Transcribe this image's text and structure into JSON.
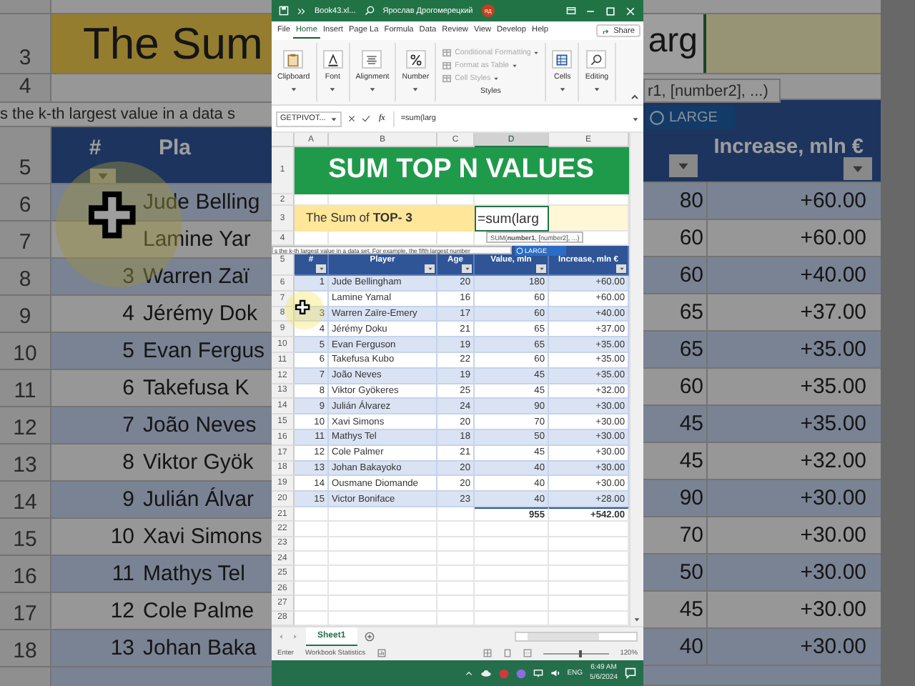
{
  "backdrop_left": {
    "title_row": {
      "row": "3",
      "text": "The Sum"
    },
    "row_4": "4",
    "description": "s the k-th largest value in a data s",
    "header": {
      "row": "5",
      "number": "#",
      "player": "Pla"
    },
    "rows": [
      {
        "row": "6",
        "player": "Jude Belling"
      },
      {
        "row": "7",
        "player": "Lamine Yar"
      },
      {
        "row": "8",
        "number": "3",
        "player": "Warren Zaï"
      },
      {
        "row": "9",
        "number": "4",
        "player": "Jérémy Dok"
      },
      {
        "row": "10",
        "number": "5",
        "player": "Evan Fergus"
      },
      {
        "row": "11",
        "number": "6",
        "player": "Takefusa K"
      },
      {
        "row": "12",
        "number": "7",
        "player": "João Neves"
      },
      {
        "row": "13",
        "number": "8",
        "player": "Viktor Gyök"
      },
      {
        "row": "14",
        "number": "9",
        "player": "Julián Álvar"
      },
      {
        "row": "15",
        "number": "10",
        "player": "Xavi Simons"
      },
      {
        "row": "16",
        "number": "11",
        "player": "Mathys Tel"
      },
      {
        "row": "17",
        "number": "12",
        "player": "Cole Palme"
      },
      {
        "row": "18",
        "number": "13",
        "player": "Johan Baka"
      }
    ]
  },
  "backdrop_right": {
    "formula_tail": "arg",
    "hint": "r1, [number2], ...)",
    "autocomplete": "LARGE",
    "header": "Increase, mln €",
    "rows": [
      {
        "value": "80",
        "increase": "+60.00"
      },
      {
        "value": "60",
        "increase": "+60.00"
      },
      {
        "value": "60",
        "increase": "+40.00"
      },
      {
        "value": "65",
        "increase": "+37.00"
      },
      {
        "value": "65",
        "increase": "+35.00"
      },
      {
        "value": "60",
        "increase": "+35.00"
      },
      {
        "value": "45",
        "increase": "+35.00"
      },
      {
        "value": "45",
        "increase": "+32.00"
      },
      {
        "value": "90",
        "increase": "+30.00"
      },
      {
        "value": "70",
        "increase": "+30.00"
      },
      {
        "value": "50",
        "increase": "+30.00"
      },
      {
        "value": "45",
        "increase": "+30.00"
      },
      {
        "value": "40",
        "increase": "+30.00"
      }
    ]
  },
  "window": {
    "title_bar": {
      "file_name": "Book43.xl...",
      "user": "Ярослав Дрогомерецкий",
      "avatar": "ЯД"
    },
    "menu_tabs": [
      {
        "label": "File",
        "selected": false
      },
      {
        "label": "Home",
        "selected": true
      },
      {
        "label": "Insert",
        "selected": false
      },
      {
        "label": "Page La",
        "selected": false
      },
      {
        "label": "Formula",
        "selected": false
      },
      {
        "label": "Data",
        "selected": false
      },
      {
        "label": "Review",
        "selected": false
      },
      {
        "label": "View",
        "selected": false
      },
      {
        "label": "Develop",
        "selected": false
      },
      {
        "label": "Help",
        "selected": false
      }
    ],
    "share_button": "Share",
    "ribbon": {
      "groups": [
        {
          "kind": "large",
          "label": "Clipboard"
        },
        {
          "kind": "large",
          "label": "Font"
        },
        {
          "kind": "large",
          "label": "Alignment"
        },
        {
          "kind": "large",
          "label": "Number"
        },
        {
          "kind": "list",
          "label": "Styles",
          "items": [
            {
              "label": "Conditional Formatting",
              "disabled": true
            },
            {
              "label": "Format as Table",
              "disabled": true
            },
            {
              "label": "Cell Styles",
              "disabled": true
            }
          ]
        },
        {
          "kind": "large",
          "label": "Cells"
        },
        {
          "kind": "large",
          "label": "Editing"
        }
      ]
    },
    "formula_bar": {
      "name_box": "GETPIVOT...",
      "function_button": "fx",
      "formula": "=sum(larg"
    },
    "sheet": {
      "columns": [
        {
          "label": "A",
          "selected": false
        },
        {
          "label": "B",
          "selected": false
        },
        {
          "label": "C",
          "selected": false
        },
        {
          "label": "D",
          "selected": true
        },
        {
          "label": "E",
          "selected": false
        }
      ],
      "title_row": {
        "row": "1",
        "text": "SUM TOP N VALUES"
      },
      "row_2": "2",
      "label_row": {
        "row": "3",
        "label": "The Sum of **TOP- 3**",
        "input": "=sum(larg"
      },
      "row_4": "4",
      "function_hint": "SUM(**number1**, [number2], ...)",
      "description": "s the k-th largest value in a data set. For example, the fifth largest number",
      "autocomplete": "LARGE",
      "header_row": {
        "row": "5",
        "headers": [
          "#",
          "Player",
          "Age",
          "Value, mln",
          "Increase, mln €"
        ]
      },
      "rows": [
        {
          "row": "6",
          "number": "1",
          "player": "Jude Bellingham",
          "age": "20",
          "value": "180",
          "increase": "+60.00"
        },
        {
          "row": "7",
          "player": "Lamine Yamal",
          "age": "16",
          "value": "60",
          "increase": "+60.00"
        },
        {
          "row": "8",
          "number": "3",
          "player": "Warren Zaïre-Emery",
          "age": "17",
          "value": "60",
          "increase": "+40.00"
        },
        {
          "row": "9",
          "number": "4",
          "player": "Jérémy Doku",
          "age": "21",
          "value": "65",
          "increase": "+37.00"
        },
        {
          "row": "10",
          "number": "5",
          "player": "Evan Ferguson",
          "age": "19",
          "value": "65",
          "increase": "+35.00"
        },
        {
          "row": "11",
          "number": "6",
          "player": "Takefusa Kubo",
          "age": "22",
          "value": "60",
          "increase": "+35.00"
        },
        {
          "row": "12",
          "number": "7",
          "player": "João Neves",
          "age": "19",
          "value": "45",
          "increase": "+35.00"
        },
        {
          "row": "13",
          "number": "8",
          "player": "Viktor Gyökeres",
          "age": "25",
          "value": "45",
          "increase": "+32.00"
        },
        {
          "row": "14",
          "number": "9",
          "player": "Julián Álvarez",
          "age": "24",
          "value": "90",
          "increase": "+30.00"
        },
        {
          "row": "15",
          "number": "10",
          "player": "Xavi Simons",
          "age": "20",
          "value": "70",
          "increase": "+30.00"
        },
        {
          "row": "16",
          "number": "11",
          "player": "Mathys Tel",
          "age": "18",
          "value": "50",
          "increase": "+30.00"
        },
        {
          "row": "17",
          "number": "12",
          "player": "Cole Palmer",
          "age": "21",
          "value": "45",
          "increase": "+30.00"
        },
        {
          "row": "18",
          "number": "13",
          "player": "Johan Bakayoko",
          "age": "20",
          "value": "40",
          "increase": "+30.00"
        },
        {
          "row": "19",
          "number": "14",
          "player": "Ousmane Diomande",
          "age": "20",
          "value": "40",
          "increase": "+30.00"
        },
        {
          "row": "20",
          "number": "15",
          "player": "Victor Boniface",
          "age": "23",
          "value": "40",
          "increase": "+28.00"
        }
      ],
      "total_row": {
        "row": "21",
        "value": "955",
        "increase": "+542.00"
      },
      "empty_rows": [
        "22",
        "23",
        "24",
        "25",
        "26",
        "27",
        "28"
      ]
    },
    "sheet_tabs": [
      {
        "label": "Sheet1",
        "selected": true
      }
    ],
    "status_bar": {
      "mode": "Enter",
      "statistics": "Workbook Statistics",
      "zoom_slider": {
        "level": 0.55
      },
      "zoom": "120%"
    },
    "taskbar": {
      "language": "ENG",
      "time": "6:49 AM",
      "date": "5/6/2024"
    }
  }
}
